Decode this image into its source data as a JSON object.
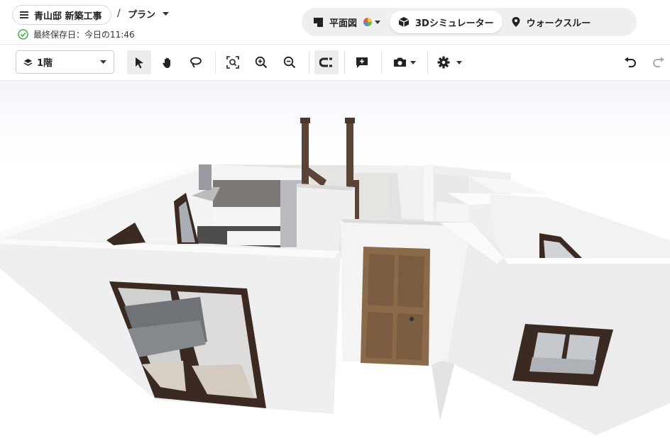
{
  "header": {
    "project_name": "青山邸 新築工事",
    "separator": "/",
    "plan_label": "プラン",
    "saved_text": "最終保存日：今日の11:46"
  },
  "modes": [
    {
      "label": "平面図",
      "icon": "floorplan-icon"
    },
    {
      "label": "3Dシミュレーター",
      "icon": "cube-icon",
      "active": true
    },
    {
      "label": "ウォークスルー",
      "icon": "map-pin-icon"
    }
  ],
  "toolbar": {
    "floor_label": "1階",
    "tools": [
      "select-arrow-icon",
      "hand-pan-icon",
      "lasso-icon",
      "zoom-fit-icon",
      "zoom-in-icon",
      "zoom-out-icon",
      "magnet-snap-icon",
      "add-comment-icon",
      "camera-icon",
      "gear-icon",
      "undo-icon",
      "redo-icon"
    ]
  },
  "colors": {
    "accent": "#4caf50",
    "wall": "#ececee",
    "door": "#8b6a4a",
    "frame": "#3a2a22"
  }
}
